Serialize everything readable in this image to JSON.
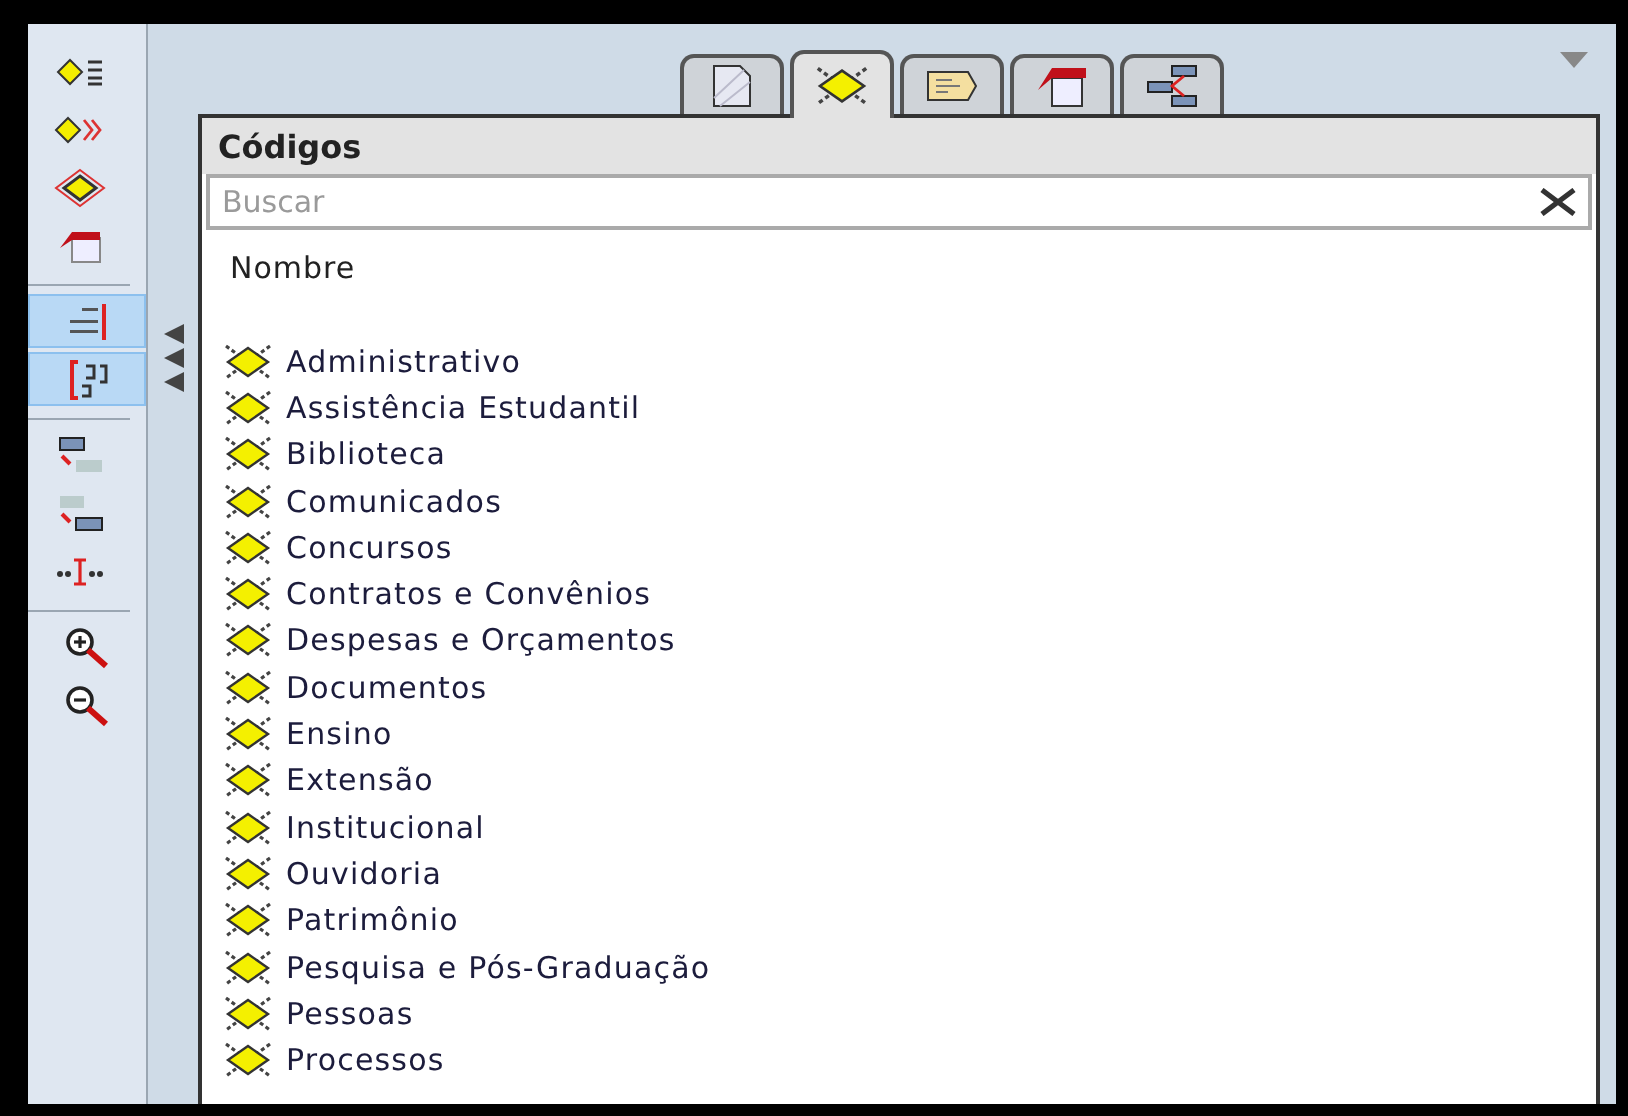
{
  "toolbar": {
    "groups": [
      {
        "items": [
          {
            "kind": "code-list",
            "selected": false
          },
          {
            "kind": "code-arrows",
            "selected": false
          },
          {
            "kind": "code-network",
            "selected": false
          },
          {
            "kind": "memo",
            "selected": false
          }
        ]
      },
      {
        "items": [
          {
            "kind": "numbers",
            "selected": true
          },
          {
            "kind": "brackets",
            "selected": true
          }
        ]
      },
      {
        "items": [
          {
            "kind": "bar-down",
            "selected": false
          },
          {
            "kind": "bar-up",
            "selected": false
          },
          {
            "kind": "quote",
            "selected": false
          }
        ]
      },
      {
        "items": [
          {
            "kind": "zoom-in",
            "selected": false
          },
          {
            "kind": "zoom-out",
            "selected": false
          }
        ]
      }
    ]
  },
  "tabs": [
    {
      "kind": "document",
      "selected": false
    },
    {
      "kind": "code",
      "selected": true
    },
    {
      "kind": "note",
      "selected": false
    },
    {
      "kind": "memo",
      "selected": false
    },
    {
      "kind": "network",
      "selected": false
    }
  ],
  "panel": {
    "title": "Códigos",
    "search": {
      "placeholder": "Buscar"
    },
    "column": "Nombre",
    "items": [
      {
        "name": "Administrativo"
      },
      {
        "name": "Assistência Estudantil"
      },
      {
        "name": "Biblioteca"
      },
      {
        "name": "Comunicados"
      },
      {
        "name": "Concursos"
      },
      {
        "name": "Contratos e Convênios"
      },
      {
        "name": "Despesas e Orçamentos"
      },
      {
        "name": "Documentos"
      },
      {
        "name": "Ensino"
      },
      {
        "name": "Extensão"
      },
      {
        "name": "Institucional"
      },
      {
        "name": "Ouvidoria"
      },
      {
        "name": "Patrimônio"
      },
      {
        "name": "Pesquisa e Pós-Graduação"
      },
      {
        "name": "Pessoas"
      },
      {
        "name": "Processos"
      }
    ]
  }
}
